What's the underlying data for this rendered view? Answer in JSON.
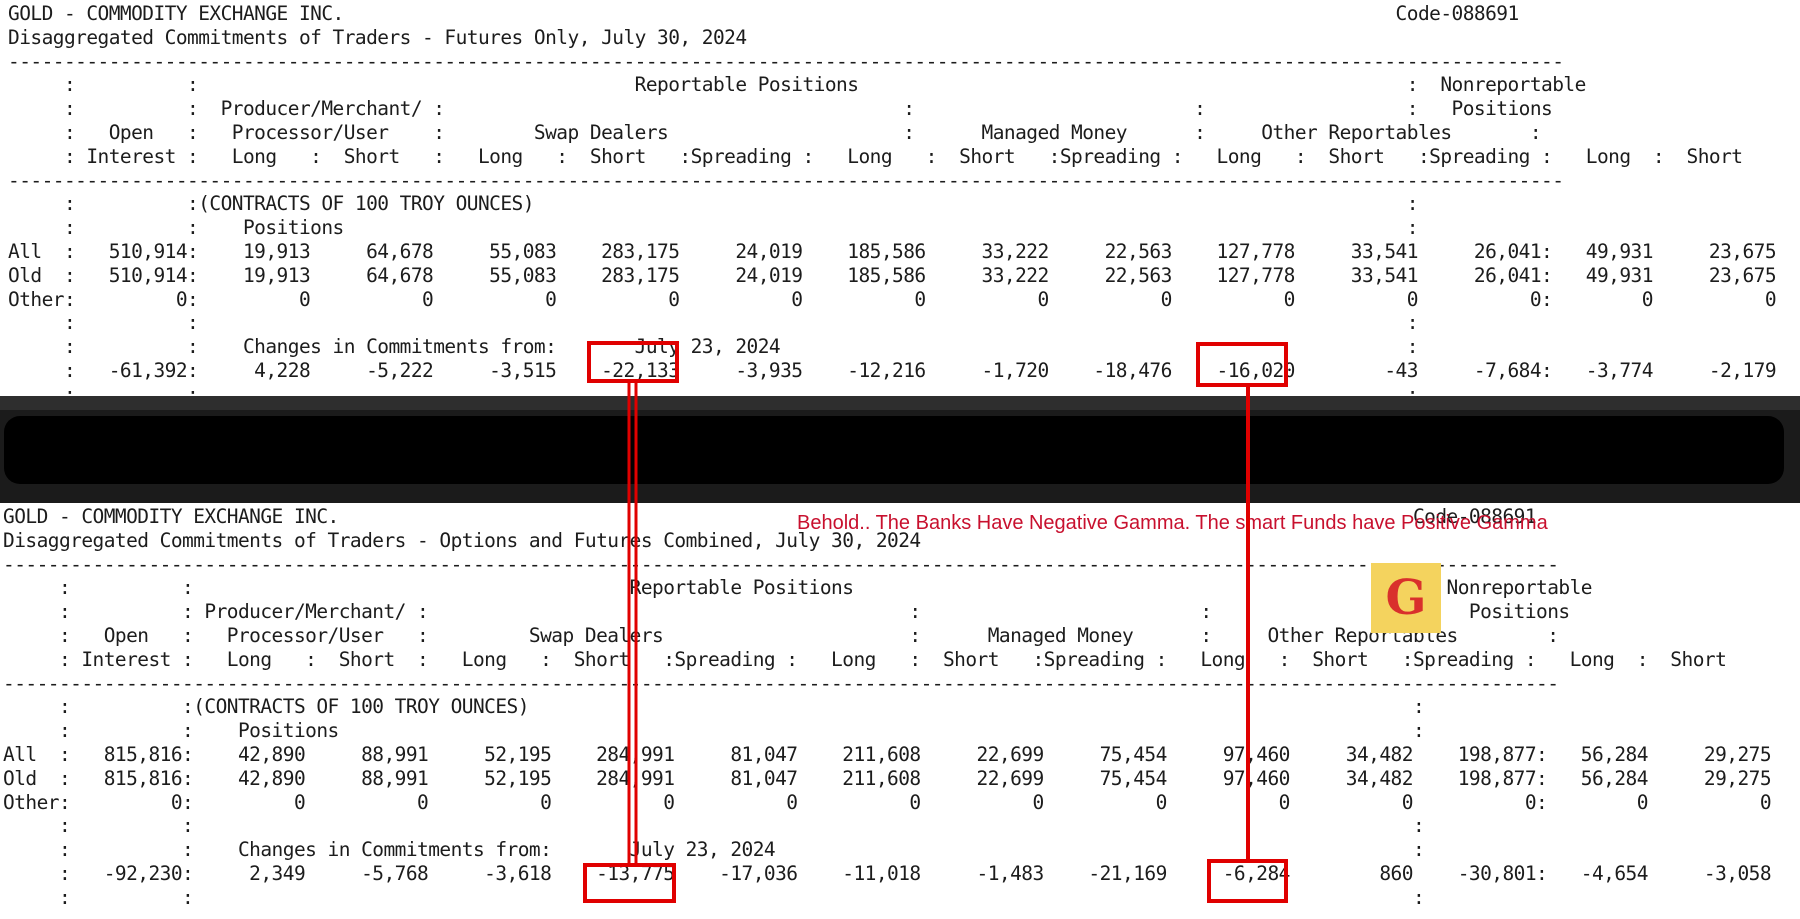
{
  "top_report": {
    "lines": [
      "GOLD - COMMODITY EXCHANGE INC.                                                                                              Code-088691",
      "Disaggregated Commitments of Traders - Futures Only, July 30, 2024",
      "-------------------------------------------------------------------------------------------------------------------------------------------",
      "     :          :                                       Reportable Positions                                                 :  Nonreportable",
      "     :          :  Producer/Merchant/ :                                         :                         :                  :   Positions",
      "     :   Open   :   Processor/User    :        Swap Dealers                     :      Managed Money      :     Other Reportables       :",
      "     : Interest :   Long   :  Short   :   Long   :  Short   :Spreading :   Long   :  Short   :Spreading :   Long   :  Short   :Spreading :   Long  :  Short",
      "-------------------------------------------------------------------------------------------------------------------------------------------",
      "     :          :(CONTRACTS OF 100 TROY OUNCES)                                                                              :",
      "     :          :    Positions                                                                                               :",
      "All  :   510,914:    19,913     64,678     55,083    283,175     24,019    185,586     33,222     22,563    127,778     33,541     26,041:   49,931     23,675",
      "Old  :   510,914:    19,913     64,678     55,083    283,175     24,019    185,586     33,222     22,563    127,778     33,541     26,041:   49,931     23,675",
      "Other:         0:         0          0          0          0          0          0          0          0          0          0          0:        0          0",
      "     :          :                                                                                                            :",
      "     :          :    Changes in Commitments from:       July 23, 2024                                                        :",
      "     :   -61,392:     4,228     -5,222     -3,515    -22,133     -3,935    -12,216     -1,720    -18,476    -16,020        -43     -7,684:   -3,774     -2,179",
      "     :          :                                                                                                            :"
    ]
  },
  "bottom_report": {
    "lines": [
      "GOLD - COMMODITY EXCHANGE INC.                                                                                                Code-088691",
      "Disaggregated Commitments of Traders - Options and Futures Combined, July 30, 2024",
      "-------------------------------------------------------------------------------------------------------------------------------------------",
      "     :          :                                       Reportable Positions                                                  :  Nonreportable",
      "     :          : Producer/Merchant/ :                                           :                         :                   :   Positions",
      "     :   Open   :   Processor/User   :         Swap Dealers                      :      Managed Money      :     Other Reportables        :",
      "     : Interest :   Long   :  Short  :   Long   :  Short   :Spreading :   Long   :  Short   :Spreading :   Long   :  Short   :Spreading :   Long  :  Short",
      "-------------------------------------------------------------------------------------------------------------------------------------------",
      "     :          :(CONTRACTS OF 100 TROY OUNCES)                                                                               :",
      "     :          :    Positions                                                                                                :",
      "All  :   815,816:    42,890     88,991     52,195    284,991     81,047    211,608     22,699     75,454     97,460     34,482    198,877:   56,284     29,275",
      "Old  :   815,816:    42,890     88,991     52,195    284,991     81,047    211,608     22,699     75,454     97,460     34,482    198,877:   56,284     29,275",
      "Other:         0:         0          0          0          0          0          0          0          0          0          0          0:        0          0",
      "     :          :                                                                                                             :",
      "     :          :    Changes in Commitments from:       July 23, 2024                                                         :",
      "     :   -92,230:     2,349     -5,768     -3,618    -13,775    -17,036    -11,018     -1,483    -21,169     -6,284        860    -30,801:   -4,654     -3,058",
      "     :          :                                                                                                             :"
    ]
  },
  "annotation": {
    "caption": "Behold.. The Banks Have Negative Gamma. The smart Funds have Positive Gamma",
    "logo_letter": "G",
    "highlight_color": "#e00000",
    "caption_color": "#c8102e",
    "logo_color": "#f4d35e"
  }
}
